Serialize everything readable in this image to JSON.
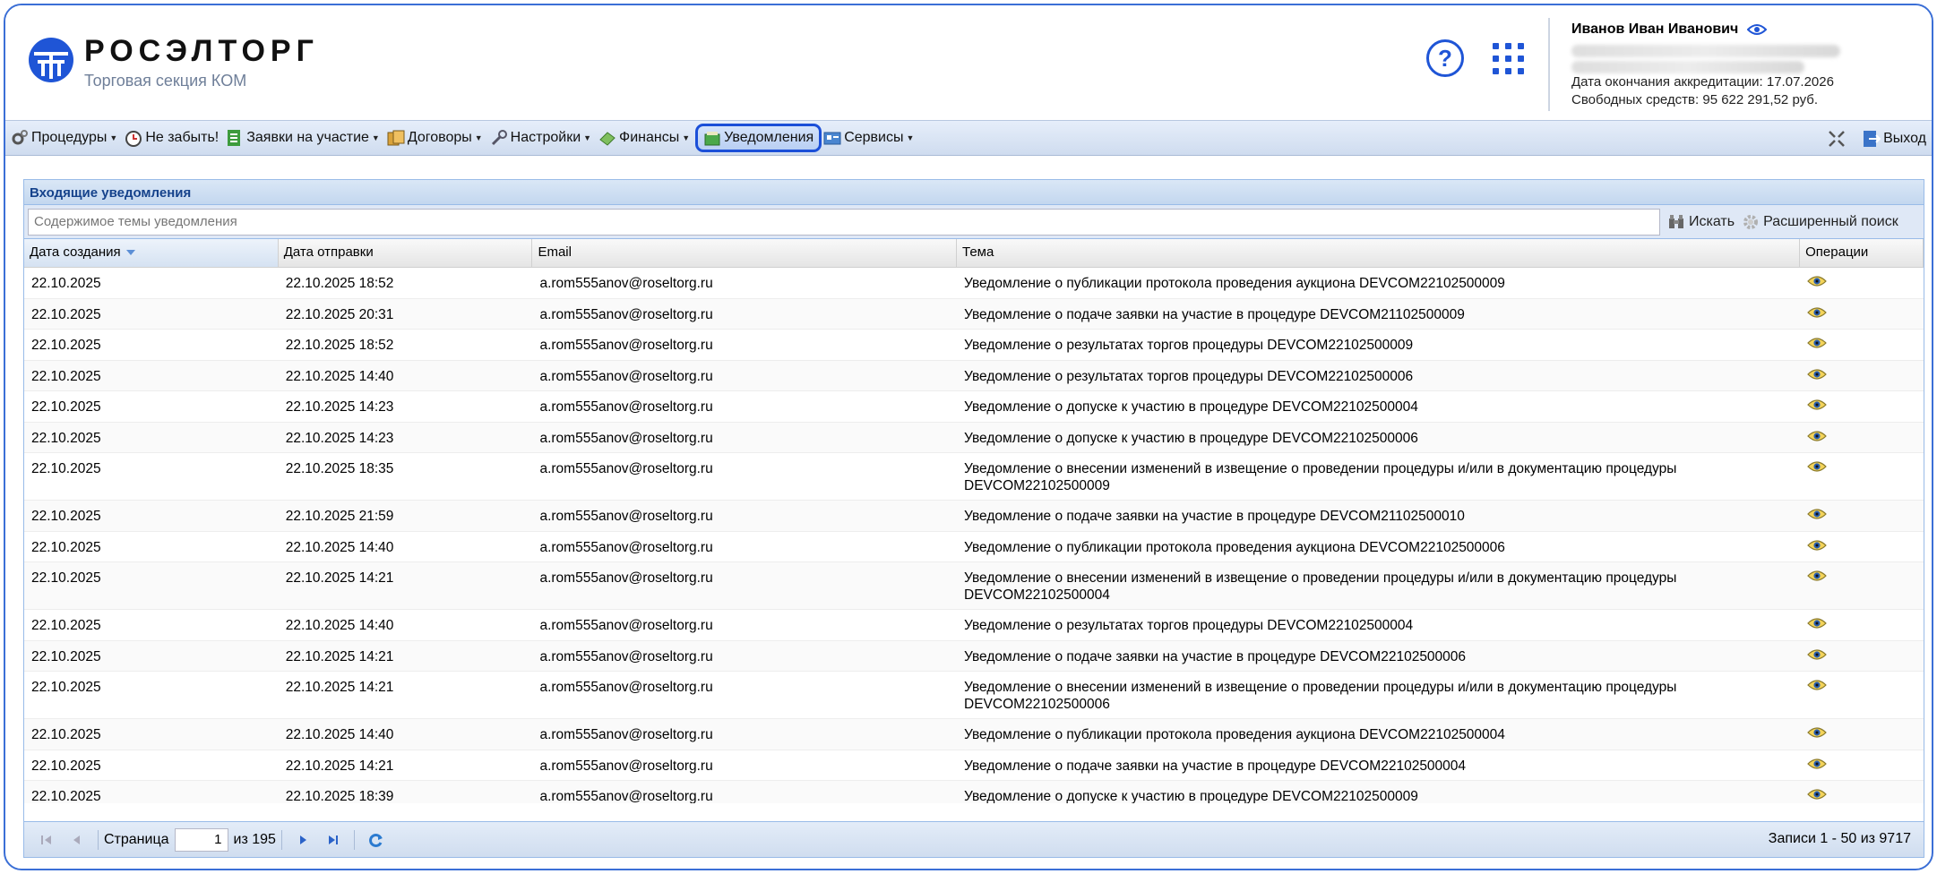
{
  "brand": {
    "title": "РОСЭЛТОРГ",
    "subtitle": "Торговая секция КОМ"
  },
  "user": {
    "name": "Иванов Иван Иванович",
    "accreditation": "Дата окончания аккредитации: 17.07.2026",
    "funds": "Свободных средств: 95 622 291,52 руб."
  },
  "toolbar": {
    "items": [
      {
        "label": "Процедуры",
        "icon": "gears-icon",
        "dropdown": true
      },
      {
        "label": "Не забыть!",
        "icon": "clock-icon",
        "dropdown": false
      },
      {
        "label": "Заявки на участие",
        "icon": "application-icon",
        "dropdown": true
      },
      {
        "label": "Договоры",
        "icon": "contracts-icon",
        "dropdown": true
      },
      {
        "label": "Настройки",
        "icon": "wrench-icon",
        "dropdown": true
      },
      {
        "label": "Финансы",
        "icon": "money-icon",
        "dropdown": true
      },
      {
        "label": "Уведомления",
        "icon": "notification-icon",
        "dropdown": false
      },
      {
        "label": "Сервисы",
        "icon": "services-icon",
        "dropdown": true
      }
    ],
    "exit_label": "Выход"
  },
  "panel": {
    "title": "Входящие уведомления",
    "search_placeholder": "Содержимое темы уведомления",
    "search_label": "Искать",
    "advanced_search_label": "Расширенный поиск"
  },
  "grid": {
    "columns": [
      "Дата создания",
      "Дата отправки",
      "Email",
      "Тема",
      "Операции"
    ],
    "rows": [
      [
        "22.10.2025",
        "22.10.2025 18:52",
        "a.rom555anov@roseltorg.ru",
        "Уведомление о публикации протокола проведения аукциона DEVCOM22102500009"
      ],
      [
        "22.10.2025",
        "22.10.2025 20:31",
        "a.rom555anov@roseltorg.ru",
        "Уведомление о подаче заявки на участие в процедуре DEVCOM21102500009"
      ],
      [
        "22.10.2025",
        "22.10.2025 18:52",
        "a.rom555anov@roseltorg.ru",
        "Уведомление о результатах торгов процедуры DEVCOM22102500009"
      ],
      [
        "22.10.2025",
        "22.10.2025 14:40",
        "a.rom555anov@roseltorg.ru",
        "Уведомление о результатах торгов процедуры DEVCOM22102500006"
      ],
      [
        "22.10.2025",
        "22.10.2025 14:23",
        "a.rom555anov@roseltorg.ru",
        "Уведомление о допуске к участию в процедуре DEVCOM22102500004"
      ],
      [
        "22.10.2025",
        "22.10.2025 14:23",
        "a.rom555anov@roseltorg.ru",
        "Уведомление о допуске к участию в процедуре DEVCOM22102500006"
      ],
      [
        "22.10.2025",
        "22.10.2025 18:35",
        "a.rom555anov@roseltorg.ru",
        "Уведомление о внесении изменений в извещение о проведении процедуры и/или в документацию процедуры DEVCOM22102500009"
      ],
      [
        "22.10.2025",
        "22.10.2025 21:59",
        "a.rom555anov@roseltorg.ru",
        "Уведомление о подаче заявки на участие в процедуре DEVCOM21102500010"
      ],
      [
        "22.10.2025",
        "22.10.2025 14:40",
        "a.rom555anov@roseltorg.ru",
        "Уведомление о публикации протокола проведения аукциона DEVCOM22102500006"
      ],
      [
        "22.10.2025",
        "22.10.2025 14:21",
        "a.rom555anov@roseltorg.ru",
        "Уведомление о внесении изменений в извещение о проведении процедуры и/или в документацию процедуры DEVCOM22102500004"
      ],
      [
        "22.10.2025",
        "22.10.2025 14:40",
        "a.rom555anov@roseltorg.ru",
        "Уведомление о результатах торгов процедуры DEVCOM22102500004"
      ],
      [
        "22.10.2025",
        "22.10.2025 14:21",
        "a.rom555anov@roseltorg.ru",
        "Уведомление о подаче заявки на участие в процедуре DEVCOM22102500006"
      ],
      [
        "22.10.2025",
        "22.10.2025 14:21",
        "a.rom555anov@roseltorg.ru",
        "Уведомление о внесении изменений в извещение о проведении процедуры и/или в документацию процедуры DEVCOM22102500006"
      ],
      [
        "22.10.2025",
        "22.10.2025 14:40",
        "a.rom555anov@roseltorg.ru",
        "Уведомление о публикации протокола проведения аукциона DEVCOM22102500004"
      ],
      [
        "22.10.2025",
        "22.10.2025 14:21",
        "a.rom555anov@roseltorg.ru",
        "Уведомление о подаче заявки на участие в процедуре DEVCOM22102500004"
      ],
      [
        "22.10.2025",
        "22.10.2025 18:39",
        "a.rom555anov@roseltorg.ru",
        "Уведомление о допуске к участию в процедуре DEVCOM22102500009"
      ]
    ]
  },
  "pager": {
    "page_label": "Страница",
    "page_value": "1",
    "of_label": "из 195",
    "records_label": "Записи 1 - 50 из 9717"
  },
  "colors": {
    "accent": "#1f55d6",
    "panel_border": "#99bbe8",
    "panel_title": "#15428b"
  }
}
